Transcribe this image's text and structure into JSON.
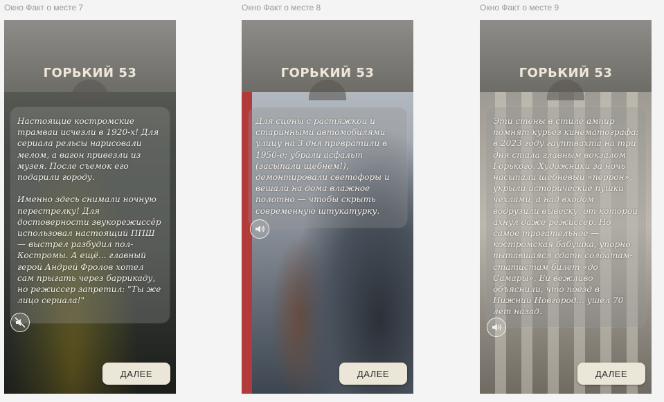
{
  "frames": [
    {
      "label": "Окно Факт о месте 7",
      "title": "ГОРЬКИЙ 53",
      "story": "Настоящие костромские трамваи исчезли в 1920-х! Для сериала рельсы нарисовали мелом, а вагон привезли из музея. После съемок его подарили городу.\n\nИменно здесь снимали ночную перестрелку! Для достоверности звукорежиссёр использовал настоящий ППШ — выстрел разбудил пол-Костромы. А ещё... главный герой Андрей Фролов хотел сам прыгать через баррикаду, но режиссер запретил: \"Ты же лицо сериала!\"",
      "sound_icon": "speaker-muted-icon",
      "next_label": "ДАЛЕЕ"
    },
    {
      "label": "Окно Факт о месте 8",
      "title": "ГОРЬКИЙ 53",
      "story": "Для сцены с растяжкой и старинными автомобилями улицу на 3 дня превратили в 1950-е: убрали асфальт (засыпали щебнем!), демонтировали светофоры и вешали на дома влажное полотно — чтобы скрыть современную штукатурку.",
      "sound_icon": "speaker-on-icon",
      "next_label": "ДАЛЕЕ"
    },
    {
      "label": "Окно Факт о месте 9",
      "title": "ГОРЬКИЙ 53",
      "story": "Эти стены в стиле ампир помнят курьез кинематографа: в 2023 году гауптвахта на три дня стала главным вокзалом Горького. Художники за ночь насыпали щебневый «перрон», укрыли исторические пушки чехлами, а над входом водрузили вывеску, от которой ахнул даже режиссер. Но самое трогательное — костромская бабушка, упорно пытавшаяся сдать солдатам-статистам билет «до Самары». Ей вежливо объяснили, что поезд в Нижний Новгород... ушел 70 лет назад.",
      "sound_icon": "speaker-on-icon",
      "next_label": "ДАЛЕЕ"
    }
  ]
}
